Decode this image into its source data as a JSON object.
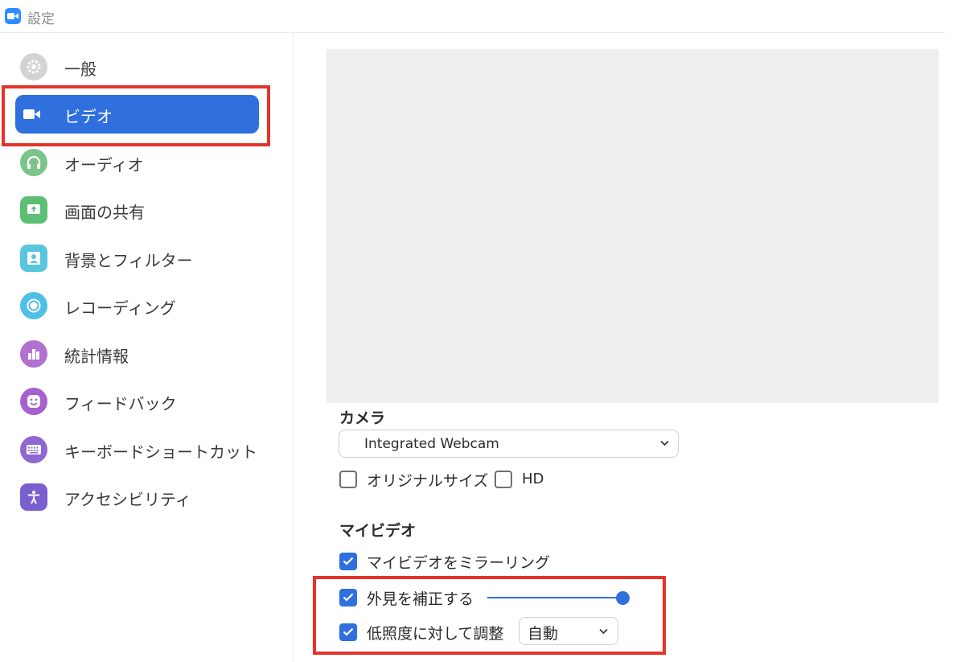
{
  "window": {
    "title": "設定"
  },
  "sidebar": {
    "items": [
      {
        "label": "一般",
        "icon": "gear-icon",
        "color": "#c8c8c8",
        "active": false
      },
      {
        "label": "ビデオ",
        "icon": "video-camera-icon",
        "color": "#ffffff",
        "active": true
      },
      {
        "label": "オーディオ",
        "icon": "headphones-icon",
        "color": "#7dc48a",
        "active": false
      },
      {
        "label": "画面の共有",
        "icon": "share-screen-icon",
        "color": "#5cbf74",
        "active": false
      },
      {
        "label": "背景とフィルター",
        "icon": "portrait-icon",
        "color": "#58c6dc",
        "active": false
      },
      {
        "label": "レコーディング",
        "icon": "record-icon",
        "color": "#4fbfe6",
        "active": false
      },
      {
        "label": "統計情報",
        "icon": "bar-chart-icon",
        "color": "#b071cf",
        "active": false
      },
      {
        "label": "フィードバック",
        "icon": "smiley-icon",
        "color": "#a760cf",
        "active": false
      },
      {
        "label": "キーボードショートカット",
        "icon": "keyboard-icon",
        "color": "#8f67d1",
        "active": false
      },
      {
        "label": "アクセシビリティ",
        "icon": "accessibility-icon",
        "color": "#7a5fcf",
        "active": false
      }
    ]
  },
  "camera": {
    "section_label": "カメラ",
    "selected": "Integrated Webcam",
    "original_size_label": "オリジナルサイズ",
    "original_size_checked": false,
    "hd_label": "HD",
    "hd_checked": false
  },
  "my_video": {
    "section_label": "マイビデオ",
    "mirror_label": "マイビデオをミラーリング",
    "mirror_checked": true,
    "touch_up_label": "外見を補正する",
    "touch_up_checked": true,
    "touch_up_level": 1.0,
    "low_light_label": "低照度に対して調整",
    "low_light_checked": true,
    "low_light_mode": "自動"
  },
  "colors": {
    "accent": "#2f6fde",
    "highlight_box": "#e4332a"
  }
}
